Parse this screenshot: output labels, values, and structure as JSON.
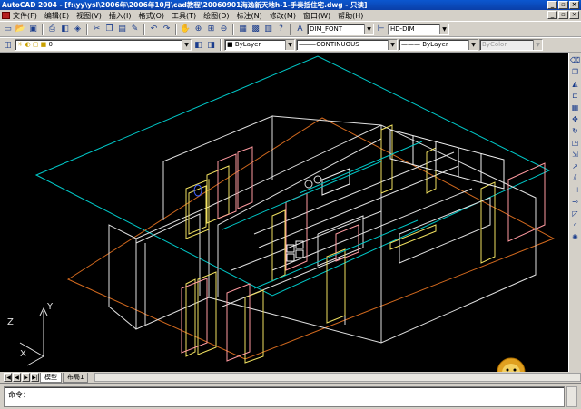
{
  "window": {
    "title": "AutoCAD 2004 - [f:\\yy\\ysl\\2006年\\2006年10月\\cad教程\\20060901海逸新天地h-1-手奏抵住宅.dwg - 只读]"
  },
  "menu": {
    "items": [
      "文件(F)",
      "编辑(E)",
      "视图(V)",
      "插入(I)",
      "格式(O)",
      "工具(T)",
      "绘图(D)",
      "标注(N)",
      "修改(M)",
      "窗口(W)",
      "帮助(H)"
    ]
  },
  "toolbar": {
    "text_style": "DIM_FONT",
    "dim_style": "HD-DIM",
    "layer": "0",
    "color": "ByLayer",
    "linetype": "CONTINUOUS",
    "lineweight": "ByLayer",
    "plotstyle": "ByColor"
  },
  "ucs": {
    "x": "X",
    "y": "Y",
    "z": "Z"
  },
  "layout_tabs": [
    "模型",
    "布局1"
  ],
  "command": {
    "prompt": "命令："
  },
  "colors": {
    "cyan": "#00c8c8",
    "orange": "#d2691e",
    "white": "#e8e8e8",
    "yellow": "#f0e060",
    "pink": "#ff9aa0"
  }
}
